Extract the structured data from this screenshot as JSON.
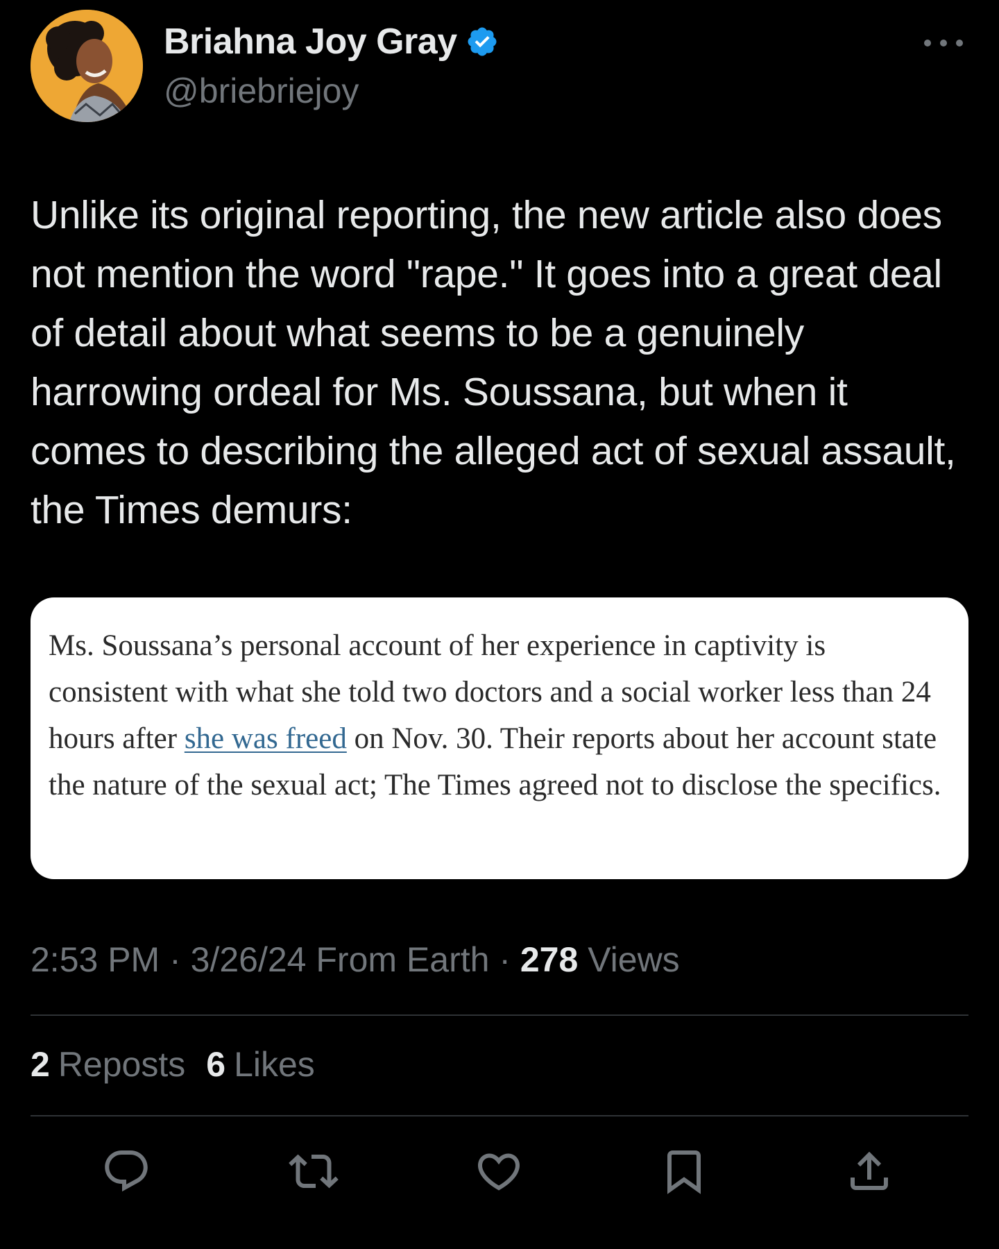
{
  "author": {
    "name": "Briahna Joy Gray",
    "handle": "@briebriejoy",
    "verified": true,
    "avatar_icon": "profile-photo"
  },
  "tweet": {
    "text": "Unlike its original reporting, the new article also does not mention the word \"rape.\" It goes into a great deal of detail about what seems to be a genuinely harrowing ordeal for Ms. Soussana, but when it comes to describing the alleged act of sexual assault, the Times demurs:"
  },
  "quote": {
    "text_before": "Ms. Soussana’s personal account of her experience in captivity is consistent with what she told two doctors and a social worker less than 24 hours after ",
    "link_text": "she was freed",
    "text_after": " on Nov. 30. Their reports about her account state the nature of the sexual act; The Times agreed not to disclose the specifics."
  },
  "meta": {
    "time": "2:53 PM",
    "sep1": " · ",
    "date": "3/26/24",
    "source": " From Earth",
    "sep2": " · ",
    "views_count": "278",
    "views_label": " Views"
  },
  "stats": {
    "reposts_count": "2",
    "reposts_label": "Reposts",
    "likes_count": "6",
    "likes_label": "Likes"
  },
  "actions": {
    "reply_icon": "reply-icon",
    "repost_icon": "repost-icon",
    "like_icon": "heart-icon",
    "bookmark_icon": "bookmark-icon",
    "share_icon": "share-icon"
  },
  "colors": {
    "background": "#000000",
    "text_primary": "#e7e9ea",
    "text_secondary": "#71767b",
    "verified_blue": "#1d9bf0",
    "divider": "#2f3336",
    "link_blue": "#326891"
  }
}
